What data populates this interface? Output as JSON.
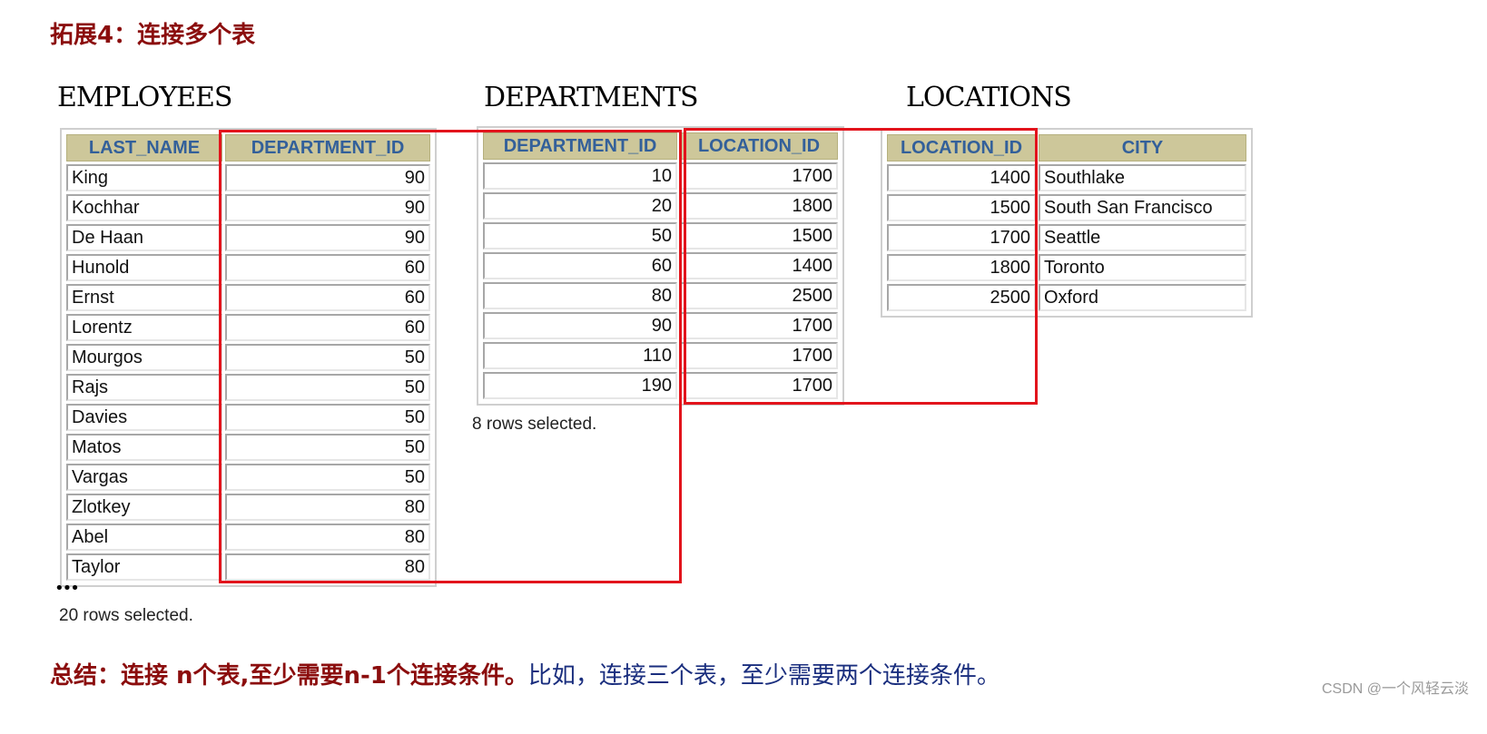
{
  "title": "拓展4：连接多个表",
  "tables": {
    "employees": {
      "name": "EMPLOYEES",
      "columns": [
        "LAST_NAME",
        "DEPARTMENT_ID"
      ],
      "rows": [
        [
          "King",
          "90"
        ],
        [
          "Kochhar",
          "90"
        ],
        [
          "De Haan",
          "90"
        ],
        [
          "Hunold",
          "60"
        ],
        [
          "Ernst",
          "60"
        ],
        [
          "Lorentz",
          "60"
        ],
        [
          "Mourgos",
          "50"
        ],
        [
          "Rajs",
          "50"
        ],
        [
          "Davies",
          "50"
        ],
        [
          "Matos",
          "50"
        ],
        [
          "Vargas",
          "50"
        ],
        [
          "Zlotkey",
          "80"
        ],
        [
          "Abel",
          "80"
        ],
        [
          "Taylor",
          "80"
        ]
      ],
      "ellipsis": "•••",
      "footer": "20 rows selected."
    },
    "departments": {
      "name": "DEPARTMENTS",
      "columns": [
        "DEPARTMENT_ID",
        "LOCATION_ID"
      ],
      "rows": [
        [
          "10",
          "1700"
        ],
        [
          "20",
          "1800"
        ],
        [
          "50",
          "1500"
        ],
        [
          "60",
          "1400"
        ],
        [
          "80",
          "2500"
        ],
        [
          "90",
          "1700"
        ],
        [
          "110",
          "1700"
        ],
        [
          "190",
          "1700"
        ]
      ],
      "footer": "8 rows selected."
    },
    "locations": {
      "name": "LOCATIONS",
      "columns": [
        "LOCATION_ID",
        "CITY"
      ],
      "rows": [
        [
          "1400",
          "Southlake"
        ],
        [
          "1500",
          "South San Francisco"
        ],
        [
          "1700",
          "Seattle"
        ],
        [
          "1800",
          "Toronto"
        ],
        [
          "2500",
          "Oxford"
        ]
      ]
    }
  },
  "summary": {
    "bold": "总结：连接 n个表,至少需要n-1个连接条件。",
    "normal": "比如，连接三个表，至少需要两个连接条件。"
  },
  "watermark": "CSDN @一个风轻云淡",
  "colors": {
    "title": "#8b0d0d",
    "header_bg": "#cdc79a",
    "header_text": "#33609a",
    "highlight_box": "#e2141c",
    "summary_normal": "#1a2e7e"
  }
}
